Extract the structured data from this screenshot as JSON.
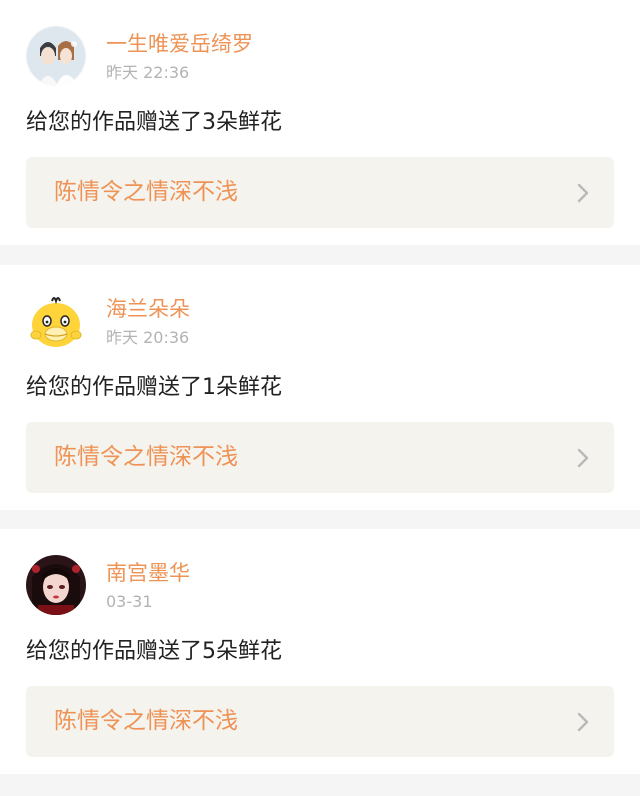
{
  "feed": {
    "items": [
      {
        "username": "一生唯爱岳绮罗",
        "time": "昨天 22:36",
        "message": "给您的作品赠送了3朵鲜花",
        "work_title": "陈情令之情深不浅"
      },
      {
        "username": "海兰朵朵",
        "time": "昨天 20:36",
        "message": "给您的作品赠送了1朵鲜花",
        "work_title": "陈情令之情深不浅"
      },
      {
        "username": "南宫墨华",
        "time": "03-31",
        "message": "给您的作品赠送了5朵鲜花",
        "work_title": "陈情令之情深不浅"
      }
    ]
  },
  "colors": {
    "accent": "#ee9355",
    "timestamp": "#b3b3b3",
    "text": "#222222",
    "link_bg": "#f5f3ee",
    "page_bg": "#f5f5f5",
    "card_bg": "#ffffff"
  },
  "icons": {
    "chevron": "chevron-right-icon"
  }
}
